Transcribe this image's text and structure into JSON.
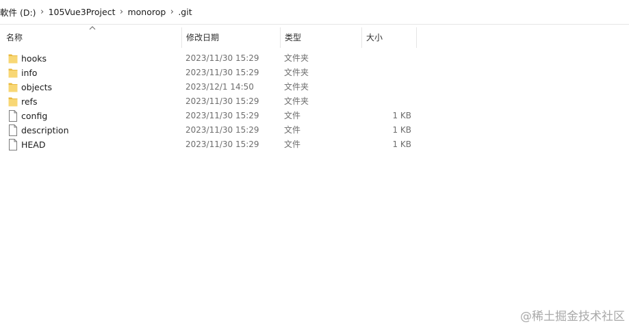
{
  "addressbar": {
    "crumbs": [
      "軟件 (D:)",
      "105Vue3Project",
      "monorop",
      ".git"
    ]
  },
  "columns": {
    "name": "名称",
    "date": "修改日期",
    "type": "类型",
    "size": "大小",
    "sorted_by": "name",
    "sort_direction": "ascending"
  },
  "files": [
    {
      "name": "hooks",
      "date": "2023/11/30 15:29",
      "type": "文件夹",
      "size": "",
      "icon": "folder-icon"
    },
    {
      "name": "info",
      "date": "2023/11/30 15:29",
      "type": "文件夹",
      "size": "",
      "icon": "folder-icon"
    },
    {
      "name": "objects",
      "date": "2023/12/1 14:50",
      "type": "文件夹",
      "size": "",
      "icon": "folder-icon"
    },
    {
      "name": "refs",
      "date": "2023/11/30 15:29",
      "type": "文件夹",
      "size": "",
      "icon": "folder-icon"
    },
    {
      "name": "config",
      "date": "2023/11/30 15:29",
      "type": "文件",
      "size": "1 KB",
      "icon": "file-icon"
    },
    {
      "name": "description",
      "date": "2023/11/30 15:29",
      "type": "文件",
      "size": "1 KB",
      "icon": "file-icon"
    },
    {
      "name": "HEAD",
      "date": "2023/11/30 15:29",
      "type": "文件",
      "size": "1 KB",
      "icon": "file-icon"
    }
  ],
  "watermark": "@稀土掘金技术社区",
  "colors": {
    "folder": "#f8d775",
    "folder_dark": "#e9b93f",
    "file_outline": "#7a7a7a",
    "divider": "#e5e5e5"
  }
}
